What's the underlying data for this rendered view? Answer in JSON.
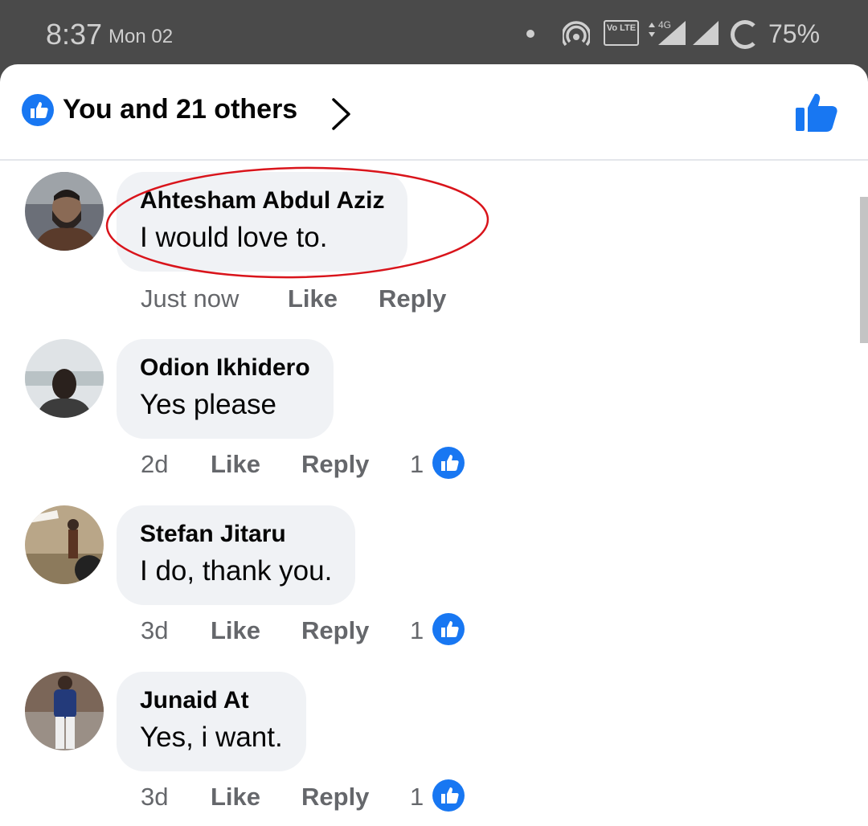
{
  "status_bar": {
    "time": "8:37",
    "date": "Mon 02",
    "volte_label": "Vo LTE",
    "network": "4G",
    "battery_percent": "75%"
  },
  "header": {
    "reactions_summary": "You and 21 others"
  },
  "comments": [
    {
      "author": "Ahtesham Abdul Aziz",
      "text": "I would love to.",
      "time": "Just now",
      "like_label": "Like",
      "reply_label": "Reply",
      "reaction_count": ""
    },
    {
      "author": "Odion Ikhidero",
      "text": "Yes please",
      "time": "2d",
      "like_label": "Like",
      "reply_label": "Reply",
      "reaction_count": "1"
    },
    {
      "author": "Stefan Jitaru",
      "text": "I do, thank you.",
      "time": "3d",
      "like_label": "Like",
      "reply_label": "Reply",
      "reaction_count": "1"
    },
    {
      "author": "Junaid At",
      "text": "Yes, i want.",
      "time": "3d",
      "like_label": "Like",
      "reply_label": "Reply",
      "reaction_count": "1"
    }
  ],
  "colors": {
    "accent": "#1877f2",
    "bubble": "#f0f2f5",
    "highlight": "#d9141b"
  },
  "icons": [
    "like-icon",
    "chevron-right-icon",
    "thumbs-up-icon",
    "hotspot-icon",
    "signal-icon",
    "battery-icon"
  ]
}
